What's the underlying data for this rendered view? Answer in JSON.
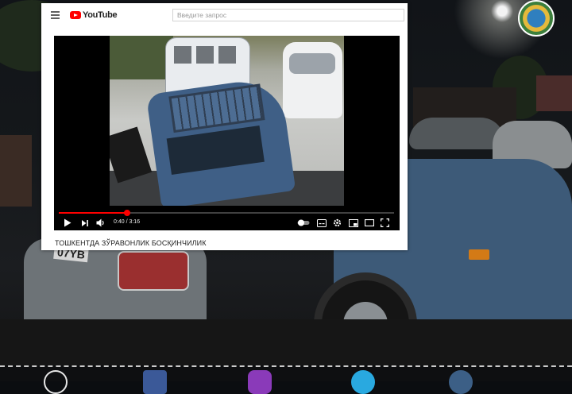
{
  "youtube": {
    "logo_text": "YouTube",
    "search_placeholder": "Введите запрос"
  },
  "player": {
    "current_time": "0:40",
    "separator": " / ",
    "duration": "3:16",
    "progress_fraction": 0.204
  },
  "video": {
    "title": "ТОШКЕНТДА ЗЎРАВОНЛИК БОСҚИНЧИЛИК"
  },
  "background": {
    "plate_text": "07YB"
  },
  "icons": {
    "menu": "hamburger-menu-icon",
    "play": "play-icon",
    "next": "next-icon",
    "volume": "volume-icon",
    "autoplay": "autoplay-toggle-icon",
    "subtitles": "subtitles-icon",
    "settings": "gear-icon",
    "miniplayer": "miniplayer-icon",
    "theater": "theater-mode-icon",
    "fullscreen": "fullscreen-icon"
  },
  "colors": {
    "youtube_red": "#ff0000",
    "card_bg": "#ffffff"
  }
}
